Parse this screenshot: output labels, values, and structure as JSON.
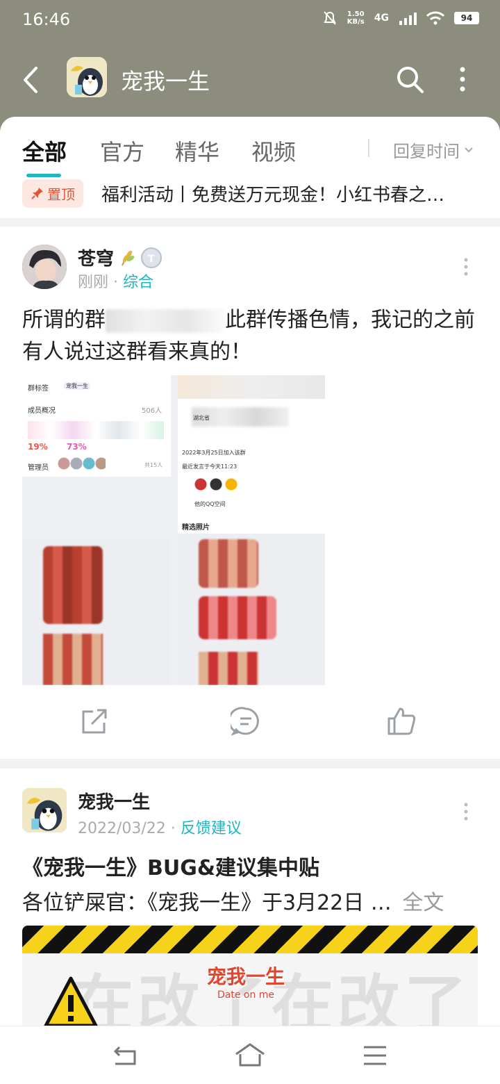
{
  "status_bar": {
    "time": "16:46",
    "speed_value": "1.50",
    "speed_unit": "KB/s",
    "network": "4G",
    "battery": "94"
  },
  "header": {
    "title": "宠我一生",
    "icons": [
      "back-icon",
      "search-icon",
      "more-icon"
    ]
  },
  "tabs": {
    "items": [
      {
        "label": "全部",
        "active": true
      },
      {
        "label": "官方",
        "active": false
      },
      {
        "label": "精华",
        "active": false
      },
      {
        "label": "视频",
        "active": false
      }
    ],
    "sort_label": "回复时间"
  },
  "pinned": {
    "badge": "置顶",
    "text": "福利活动丨免费送万元现金！小红书春之…"
  },
  "posts": [
    {
      "author": "苍穹",
      "time": "刚刚",
      "category": "综合",
      "text_before": "所谓的群",
      "text_after": "此群传播色情，我记的之前有人说过这群看来真的！",
      "screenshot_texts": {
        "group_tag": "群标签",
        "tag_value": "宠我一生",
        "members": "成员概况",
        "member_count": "506人",
        "admin": "管理员",
        "admin_count": "共15人",
        "pct1": "19%",
        "pct2": "73%",
        "joined": "2022年3月25日加入该群",
        "last_speak": "最近发言于今天11:23",
        "region": "湖北省",
        "qq_space": "他的QQ空间",
        "photos": "精选照片"
      }
    },
    {
      "author": "宠我一生",
      "time": "2022/03/22",
      "category": "反馈建议",
      "title": "《宠我一生》BUG&建议集中贴",
      "summary": "各位铲屎官：《宠我一生》于3月22日 …",
      "full_text_link": "全文",
      "banner_text": "在改了在改了",
      "banner_logo": "宠我一生",
      "banner_logo_sub": "Date on me"
    }
  ],
  "colors": {
    "accent": "#1fb6c4",
    "header_bg": "#8c8d7d",
    "pin_red": "#e0573a"
  }
}
